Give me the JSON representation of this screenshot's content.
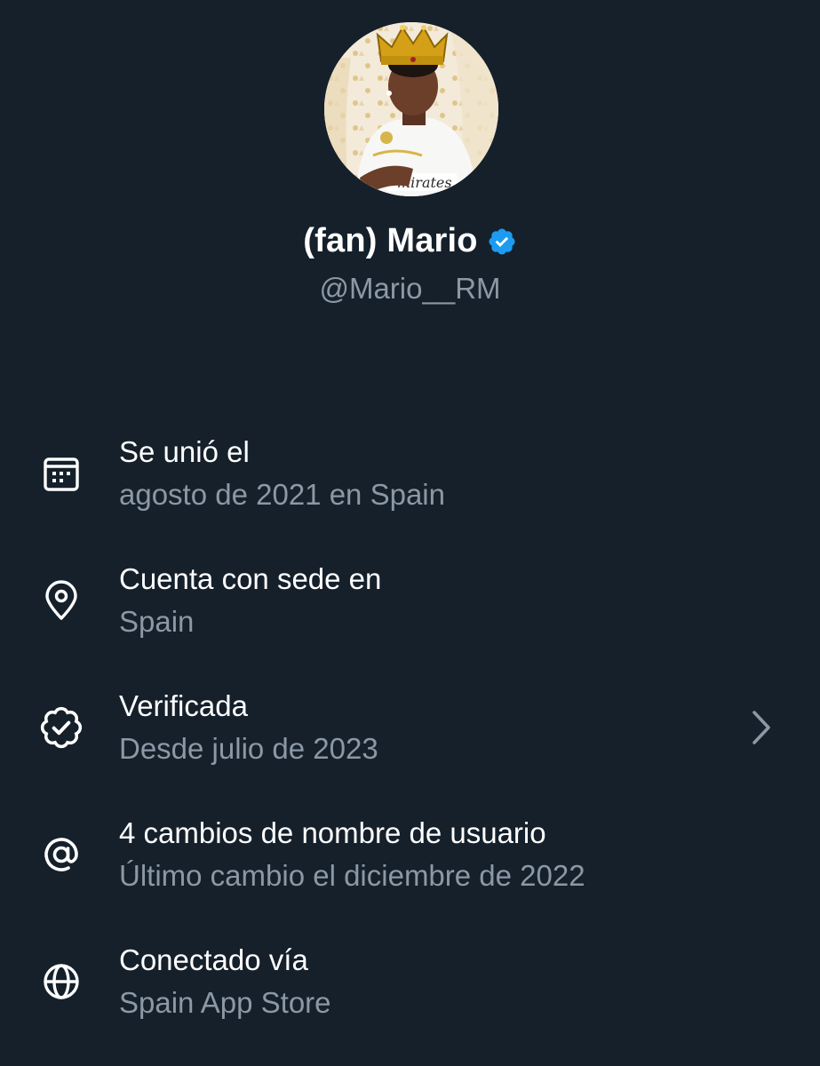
{
  "profile": {
    "display_name": "(fan) Mario",
    "handle": "@Mario__RM",
    "verified_badge_icon": "verified-check-icon",
    "verified_badge_color": "#1d9bf0"
  },
  "info_rows": [
    {
      "icon": "calendar-icon",
      "title": "Se unió el",
      "subtitle": "agosto de 2021 en Spain"
    },
    {
      "icon": "location-pin-icon",
      "title": "Cuenta con sede en",
      "subtitle": "Spain"
    },
    {
      "icon": "verified-badge-outline-icon",
      "title": "Verificada",
      "subtitle": "Desde julio de 2023",
      "chevron_icon": "chevron-right-icon"
    },
    {
      "icon": "at-sign-icon",
      "title": "4 cambios de nombre de usuario",
      "subtitle": "Último cambio el diciembre de 2022"
    },
    {
      "icon": "globe-icon",
      "title": "Conectado vía",
      "subtitle": "Spain App Store"
    }
  ],
  "colors": {
    "background": "#15202b",
    "primary_text": "#ffffff",
    "secondary_text": "#8b98a5",
    "accent": "#1d9bf0"
  }
}
